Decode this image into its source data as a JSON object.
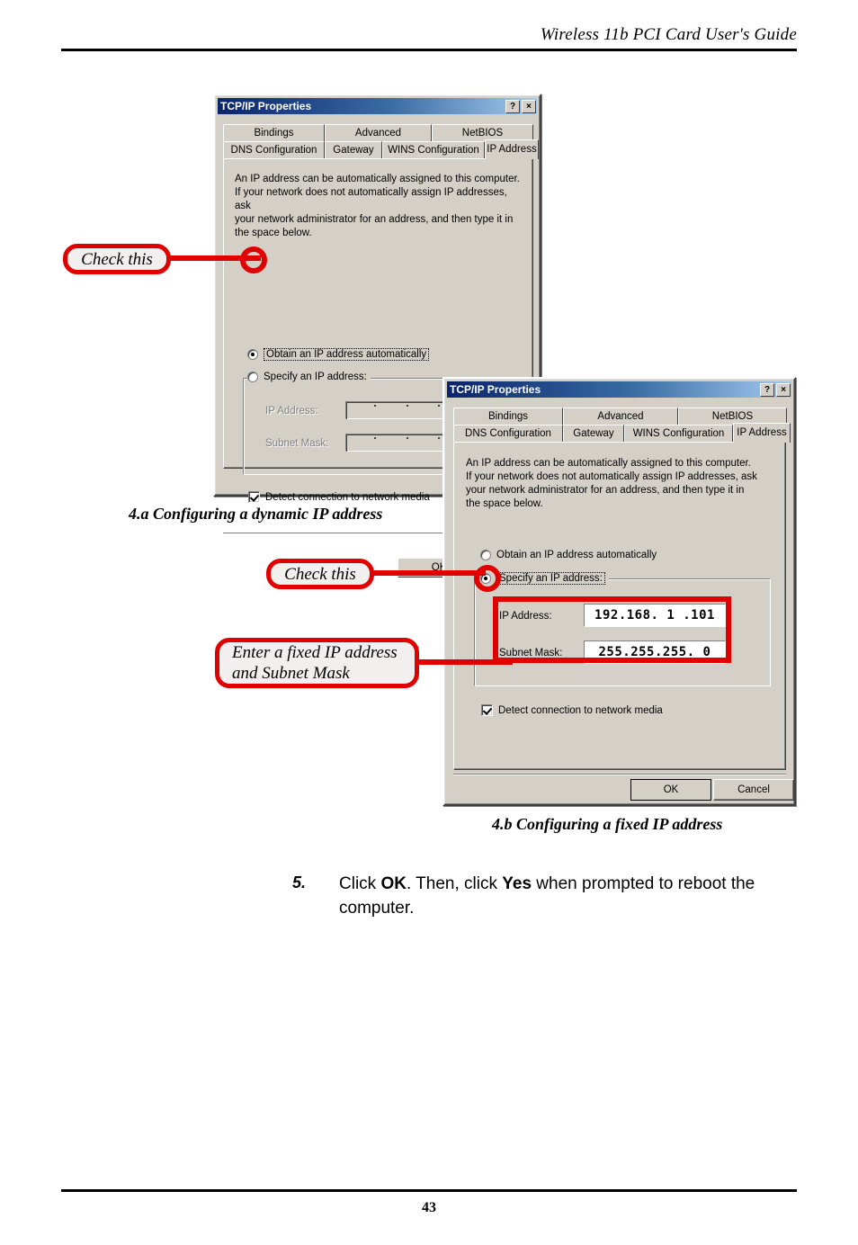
{
  "header": {
    "running_title": "Wireless 11b PCI Card User's Guide"
  },
  "footer": {
    "page_number": "43"
  },
  "dialog_a": {
    "title": "TCP/IP Properties",
    "help_button": "?",
    "close_button": "×",
    "tabs_row1": [
      "Bindings",
      "Advanced",
      "NetBIOS"
    ],
    "tabs_row2": [
      "DNS Configuration",
      "Gateway",
      "WINS Configuration",
      "IP Address"
    ],
    "active_tab": "IP Address",
    "description": "An IP address can be automatically assigned to this computer.\nIf your network does not automatically assign IP addresses, ask\nyour network administrator for an address, and then type it in\nthe space below.",
    "radio_auto": "Obtain an IP address automatically",
    "radio_auto_underline": "O",
    "radio_specify": "Specify an IP address:",
    "radio_specify_underline": "S",
    "selected_option": "Obtain an IP address automatically",
    "ip_label": "IP Address:",
    "ip_label_underline": "I",
    "subnet_label": "Subnet Mask:",
    "subnet_label_underline": "u",
    "ip_value": "",
    "subnet_value": "",
    "fields_disabled": true,
    "detect_checkbox_label": "Detect connection to network media",
    "detect_checkbox_underline": "D",
    "detect_checked": true,
    "ok_button": "OK"
  },
  "dialog_b": {
    "title": "TCP/IP Properties",
    "help_button": "?",
    "close_button": "×",
    "tabs_row1": [
      "Bindings",
      "Advanced",
      "NetBIOS"
    ],
    "tabs_row2": [
      "DNS Configuration",
      "Gateway",
      "WINS Configuration",
      "IP Address"
    ],
    "active_tab": "IP Address",
    "description": "An IP address can be automatically assigned to this computer.\nIf your network does not automatically assign IP addresses, ask\nyour network administrator for an address, and then type it in\nthe space below.",
    "radio_auto": "Obtain an IP address automatically",
    "radio_auto_underline": "O",
    "radio_specify": "Specify an IP address:",
    "radio_specify_underline": "S",
    "selected_option": "Specify an IP address:",
    "ip_label": "IP Address:",
    "ip_label_underline": "I",
    "subnet_label": "Subnet Mask:",
    "subnet_label_underline": "u",
    "ip_value": "192.168. 1 .101",
    "subnet_value": "255.255.255. 0",
    "fields_disabled": false,
    "detect_checkbox_label": "Detect connection to network media",
    "detect_checkbox_underline": "D",
    "detect_checked": true,
    "ok_button": "OK",
    "cancel_button": "Cancel"
  },
  "annotations": {
    "callout_a_check": "Check this",
    "callout_b_check": "Check this",
    "callout_b_fields": "Enter a fixed IP address\nand Subnet Mask",
    "accent_color": "#e00000"
  },
  "captions": {
    "figure_a": "4.a Configuring a dynamic IP address",
    "figure_b": "4.b Configuring a fixed IP address"
  },
  "step": {
    "number": "5.",
    "text_part1": "Click ",
    "bold1": "OK",
    "text_part2": ".  Then, click ",
    "bold2": "Yes",
    "text_part3": " when prompted to reboot the computer."
  }
}
